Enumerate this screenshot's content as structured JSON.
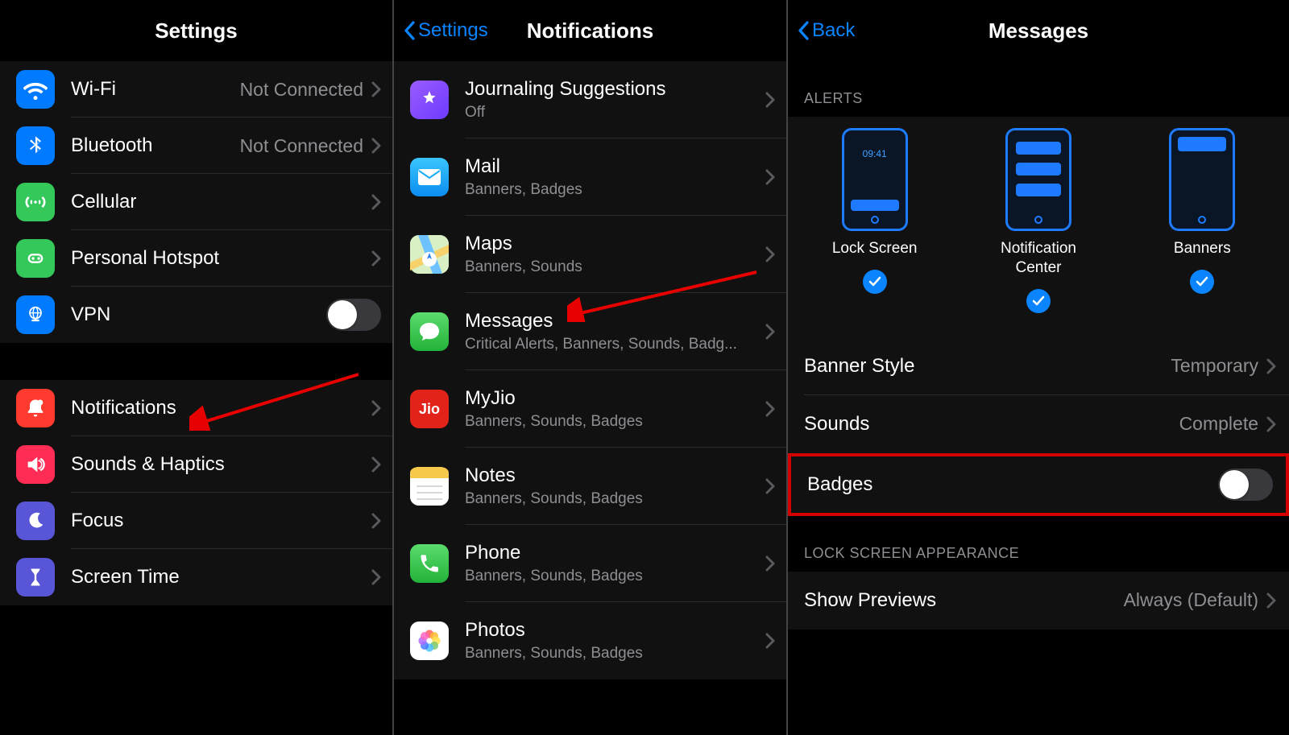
{
  "panel1": {
    "title": "Settings",
    "group1": [
      {
        "icon": "wifi",
        "bg": "#007aff",
        "label": "Wi-Fi",
        "value": "Not Connected",
        "chevron": true
      },
      {
        "icon": "bluetooth",
        "bg": "#007aff",
        "label": "Bluetooth",
        "value": "Not Connected",
        "chevron": true
      },
      {
        "icon": "cellular",
        "bg": "#34c759",
        "label": "Cellular",
        "value": "",
        "chevron": true
      },
      {
        "icon": "hotspot",
        "bg": "#34c759",
        "label": "Personal Hotspot",
        "value": "",
        "chevron": true
      },
      {
        "icon": "vpn",
        "bg": "#007aff",
        "label": "VPN",
        "toggle": true
      }
    ],
    "group2": [
      {
        "icon": "notifications",
        "bg": "#ff3b30",
        "label": "Notifications",
        "chevron": true
      },
      {
        "icon": "sounds",
        "bg": "#ff2d55",
        "label": "Sounds & Haptics",
        "chevron": true
      },
      {
        "icon": "focus",
        "bg": "#5856d6",
        "label": "Focus",
        "chevron": true
      },
      {
        "icon": "screentime",
        "bg": "#5856d6",
        "label": "Screen Time",
        "chevron": true
      }
    ]
  },
  "panel2": {
    "back": "Settings",
    "title": "Notifications",
    "apps": [
      {
        "icon": "journal",
        "bg": "#7b4dff",
        "label": "Journaling Suggestions",
        "sub": "Off"
      },
      {
        "icon": "mail",
        "bg": "#1badf8",
        "label": "Mail",
        "sub": "Banners, Badges"
      },
      {
        "icon": "maps",
        "bg": "#ffffff",
        "label": "Maps",
        "sub": "Banners, Sounds"
      },
      {
        "icon": "messages",
        "bg": "#34c759",
        "label": "Messages",
        "sub": "Critical Alerts, Banners, Sounds, Badg..."
      },
      {
        "icon": "myjio",
        "bg": "#e2231a",
        "label": "MyJio",
        "sub": "Banners, Sounds, Badges"
      },
      {
        "icon": "notes",
        "bg": "#ffffff",
        "label": "Notes",
        "sub": "Banners, Sounds, Badges"
      },
      {
        "icon": "phone",
        "bg": "#34c759",
        "label": "Phone",
        "sub": "Banners, Sounds, Badges"
      },
      {
        "icon": "photos",
        "bg": "#ffffff",
        "label": "Photos",
        "sub": "Banners, Sounds, Badges"
      }
    ]
  },
  "panel3": {
    "back": "Back",
    "title": "Messages",
    "alertsHeader": "ALERTS",
    "alertOptions": [
      {
        "label1": "Lock Screen",
        "label2": ""
      },
      {
        "label1": "Notification",
        "label2": "Center"
      },
      {
        "label1": "Banners",
        "label2": ""
      }
    ],
    "bannerStyle": {
      "label": "Banner Style",
      "value": "Temporary"
    },
    "sounds": {
      "label": "Sounds",
      "value": "Complete"
    },
    "badges": {
      "label": "Badges"
    },
    "lockHeader": "LOCK SCREEN APPEARANCE",
    "showPreviews": {
      "label": "Show Previews",
      "value": "Always (Default)"
    },
    "time": "09:41"
  }
}
